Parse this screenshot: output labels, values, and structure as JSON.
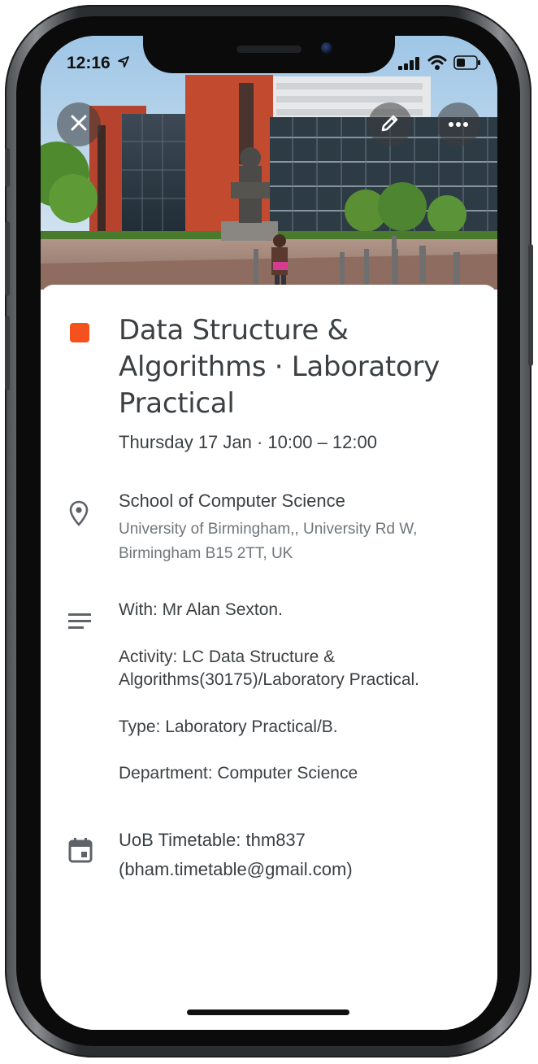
{
  "status_bar": {
    "time": "12:16",
    "icons": [
      "location-arrow-icon",
      "cellular-signal-icon",
      "wifi-icon",
      "battery-icon"
    ]
  },
  "header": {
    "image": "university-building-photo",
    "close_icon": "close-icon",
    "edit_icon": "edit-pencil-icon",
    "more_icon": "more-options-icon"
  },
  "event": {
    "color": "#f4511e",
    "title_line1": "Data Structure &",
    "title_line2": "Algorithms · Laboratory",
    "title_line3": "Practical",
    "datetime": "Thursday 17 Jan · 10:00 – 12:00"
  },
  "location": {
    "icon": "location-pin-icon",
    "name": "School of Computer Science",
    "address_line1": "University of Birmingham,, University Rd W,",
    "address_line2": "Birmingham B15 2TT, UK"
  },
  "description": {
    "icon": "notes-icon",
    "with": "With: Mr Alan Sexton.",
    "activity_line1": "Activity: LC Data Structure &",
    "activity_line2": "Algorithms(30175)/Laboratory Practical.",
    "type": "Type: Laboratory Practical/B.",
    "department": "Department: Computer Science"
  },
  "calendar": {
    "icon": "calendar-icon",
    "name_line1": "UoB Timetable: thm837",
    "name_line2": "(bham.timetable@gmail.com)"
  }
}
